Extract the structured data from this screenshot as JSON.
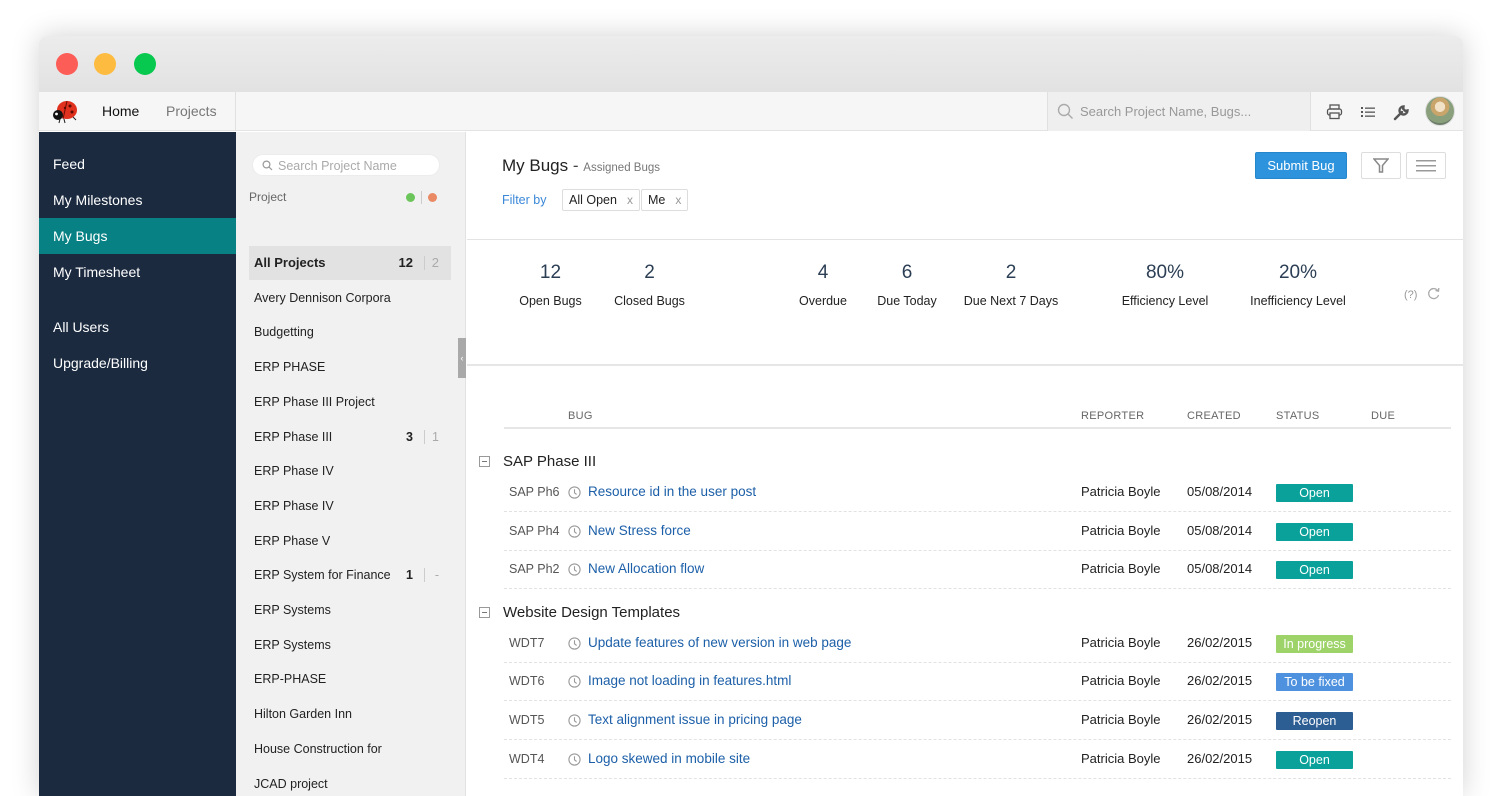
{
  "window": {
    "traffic_lights": [
      "close",
      "minimize",
      "maximize"
    ]
  },
  "topnav": {
    "logo": "ladybug-logo",
    "home_label": "Home",
    "projects_label": "Projects",
    "search_placeholder": "Search Project Name, Bugs...",
    "icons": [
      "printer-icon",
      "list-icon",
      "wrench-icon",
      "user-avatar"
    ]
  },
  "sidebar": {
    "items": [
      {
        "label": "Feed",
        "active": false
      },
      {
        "label": "My Milestones",
        "active": false
      },
      {
        "label": "My Bugs",
        "active": true
      },
      {
        "label": "My Timesheet",
        "active": false
      },
      {
        "label": "All Users",
        "active": false
      },
      {
        "label": "Upgrade/Billing",
        "active": false
      }
    ],
    "active_color": "#078184",
    "background": "#1b2a3f"
  },
  "project_panel": {
    "search_placeholder": "Search Project Name",
    "header_label": "Project",
    "legend_colors": {
      "open": "#6cc55a",
      "closed": "#e98a64"
    },
    "items": [
      {
        "name": "All Projects",
        "open": "12",
        "closed": "2",
        "active": true
      },
      {
        "name": "Avery Dennison Corpora",
        "open": null,
        "closed": null
      },
      {
        "name": "Budgetting",
        "open": null,
        "closed": null
      },
      {
        "name": "ERP PHASE",
        "open": null,
        "closed": null
      },
      {
        "name": "ERP Phase III Project",
        "open": null,
        "closed": null
      },
      {
        "name": "ERP Phase III",
        "open": "3",
        "closed": "1"
      },
      {
        "name": "ERP Phase IV",
        "open": null,
        "closed": null
      },
      {
        "name": "ERP Phase IV",
        "open": null,
        "closed": null
      },
      {
        "name": "ERP Phase V",
        "open": null,
        "closed": null
      },
      {
        "name": "ERP System for Finance",
        "open": "1",
        "closed": "-"
      },
      {
        "name": "ERP Systems",
        "open": null,
        "closed": null
      },
      {
        "name": "ERP Systems",
        "open": null,
        "closed": null
      },
      {
        "name": "ERP-PHASE",
        "open": null,
        "closed": null
      },
      {
        "name": "Hilton Garden Inn",
        "open": null,
        "closed": null
      },
      {
        "name": "House Construction for",
        "open": null,
        "closed": null
      },
      {
        "name": "JCAD project",
        "open": null,
        "closed": null
      }
    ]
  },
  "main": {
    "title": "My Bugs",
    "title_sep": "-",
    "subtitle": "Assigned Bugs",
    "filter_label": "Filter by",
    "filters": [
      {
        "label": "All Open",
        "remove": "x"
      },
      {
        "label": "Me",
        "remove": "x"
      }
    ],
    "submit_button": "Submit Bug",
    "stats": [
      {
        "value": "12",
        "label": "Open Bugs"
      },
      {
        "value": "2",
        "label": "Closed Bugs"
      },
      {
        "value": "4",
        "label": "Overdue"
      },
      {
        "value": "6",
        "label": "Due Today"
      },
      {
        "value": "2",
        "label": "Due Next 7 Days"
      },
      {
        "value": "80%",
        "label": "Efficiency Level"
      },
      {
        "value": "20%",
        "label": "Inefficiency Level"
      }
    ],
    "help_label": "(?)",
    "columns": {
      "bug": "BUG",
      "reporter": "REPORTER",
      "created": "CREATED",
      "status": "STATUS",
      "due": "DUE"
    },
    "status_colors": {
      "Open": "#0aa19a",
      "In progress": "#9ed36a",
      "To be fixed": "#4e91de",
      "Reopen": "#2c5d93"
    },
    "groups": [
      {
        "name": "SAP Phase III",
        "bugs": [
          {
            "id": "SAP Ph6",
            "title": "Resource id in the user post",
            "reporter": "Patricia Boyle",
            "created": "05/08/2014",
            "status": "Open",
            "due": ""
          },
          {
            "id": "SAP Ph4",
            "title": "New Stress force",
            "reporter": "Patricia Boyle",
            "created": "05/08/2014",
            "status": "Open",
            "due": ""
          },
          {
            "id": "SAP Ph2",
            "title": "New Allocation flow",
            "reporter": "Patricia Boyle",
            "created": "05/08/2014",
            "status": "Open",
            "due": ""
          }
        ]
      },
      {
        "name": "Website Design Templates",
        "bugs": [
          {
            "id": "WDT7",
            "title": "Update features of new version in web page",
            "reporter": "Patricia Boyle",
            "created": "26/02/2015",
            "status": "In progress",
            "due": ""
          },
          {
            "id": "WDT6",
            "title": "Image not loading in features.html",
            "reporter": "Patricia Boyle",
            "created": "26/02/2015",
            "status": "To be fixed",
            "due": ""
          },
          {
            "id": "WDT5",
            "title": "Text alignment issue in pricing page",
            "reporter": "Patricia Boyle",
            "created": "26/02/2015",
            "status": "Reopen",
            "due": ""
          },
          {
            "id": "WDT4",
            "title": "Logo skewed in mobile site",
            "reporter": "Patricia Boyle",
            "created": "26/02/2015",
            "status": "Open",
            "due": ""
          }
        ]
      }
    ]
  }
}
